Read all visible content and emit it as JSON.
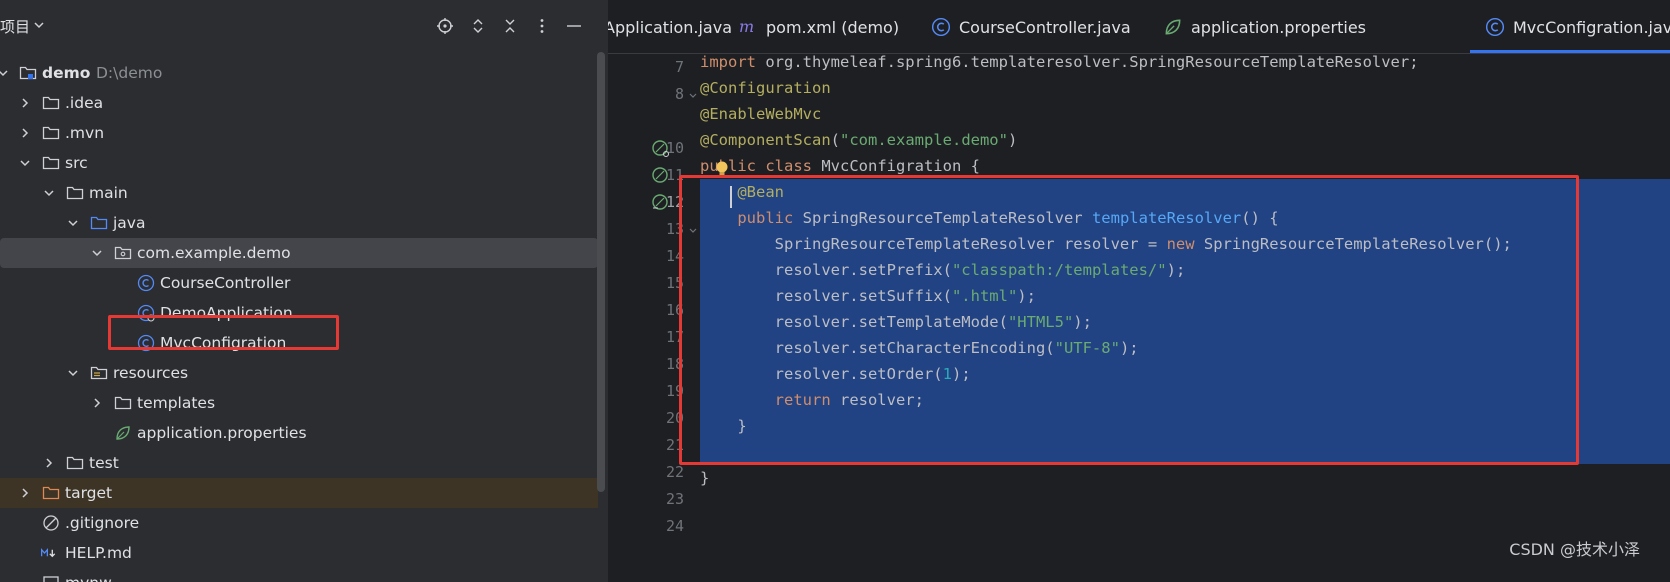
{
  "project_panel": {
    "title": "项目",
    "tree": [
      {
        "label": "demo",
        "path": "D:\\demo"
      },
      {
        "label": ".idea"
      },
      {
        "label": ".mvn"
      },
      {
        "label": "src"
      },
      {
        "label": "main"
      },
      {
        "label": "java"
      },
      {
        "label": "com.example.demo"
      },
      {
        "label": "CourseController"
      },
      {
        "label": "DemoApplication"
      },
      {
        "label": "MvcConfigration"
      },
      {
        "label": "resources"
      },
      {
        "label": "templates"
      },
      {
        "label": "application.properties"
      },
      {
        "label": "test"
      },
      {
        "label": "target"
      },
      {
        "label": ".gitignore"
      },
      {
        "label": "HELP.md"
      },
      {
        "label": "mvnw"
      }
    ]
  },
  "tabs": [
    {
      "label": "Application.java"
    },
    {
      "label": "pom.xml (demo)"
    },
    {
      "label": "CourseController.java"
    },
    {
      "label": "application.properties"
    },
    {
      "label": "MvcConfigration.java"
    }
  ],
  "code": {
    "line_numbers": [
      "7",
      "8",
      "10",
      "11",
      "12",
      "13",
      "14",
      "15",
      "16",
      "17",
      "18",
      "19",
      "20",
      "21",
      "22",
      "23",
      "24"
    ],
    "lines": [
      {
        "tokens": [
          [
            "kw",
            "import "
          ],
          [
            "plain",
            "org.thymeleaf.spring6.templateresolver.SpringResourceTemplateResolver;"
          ]
        ]
      },
      {
        "tokens": [
          [
            "ann",
            "@Configuration"
          ]
        ]
      },
      {
        "tokens": [
          [
            "ann",
            "@EnableWebMvc"
          ]
        ]
      },
      {
        "tokens": [
          [
            "ann",
            "@ComponentScan"
          ],
          [
            "plain",
            "("
          ],
          [
            "str",
            "\"com.example.demo\""
          ],
          [
            "plain",
            ")"
          ]
        ]
      },
      {
        "tokens": [
          [
            "kw",
            "public class "
          ],
          [
            "plain",
            "MvcConfigration {"
          ]
        ]
      },
      {
        "tokens": [
          [
            "plain",
            "    "
          ],
          [
            "ann",
            "@Bean"
          ]
        ]
      },
      {
        "tokens": [
          [
            "plain",
            "    "
          ],
          [
            "kw",
            "public "
          ],
          [
            "plain",
            "SpringResourceTemplateResolver "
          ],
          [
            "fn",
            "templateResolver"
          ],
          [
            "plain",
            "() {"
          ]
        ]
      },
      {
        "tokens": [
          [
            "plain",
            "        SpringResourceTemplateResolver resolver = "
          ],
          [
            "kw",
            "new "
          ],
          [
            "plain",
            "SpringResourceTemplateResolver();"
          ]
        ]
      },
      {
        "tokens": [
          [
            "plain",
            "        resolver.setPrefix("
          ],
          [
            "str",
            "\"classpath:/templates/\""
          ],
          [
            "plain",
            ");"
          ]
        ]
      },
      {
        "tokens": [
          [
            "plain",
            "        resolver.setSuffix("
          ],
          [
            "str",
            "\".html\""
          ],
          [
            "plain",
            ");"
          ]
        ]
      },
      {
        "tokens": [
          [
            "plain",
            "        resolver.setTemplateMode("
          ],
          [
            "str",
            "\"HTML5\""
          ],
          [
            "plain",
            ");"
          ]
        ]
      },
      {
        "tokens": [
          [
            "plain",
            "        resolver.setCharacterEncoding("
          ],
          [
            "str",
            "\"UTF-8\""
          ],
          [
            "plain",
            ");"
          ]
        ]
      },
      {
        "tokens": [
          [
            "plain",
            "        resolver.setOrder("
          ],
          [
            "num",
            "1"
          ],
          [
            "plain",
            ");"
          ]
        ]
      },
      {
        "tokens": [
          [
            "plain",
            "        "
          ],
          [
            "kw",
            "return "
          ],
          [
            "plain",
            "resolver;"
          ]
        ]
      },
      {
        "tokens": [
          [
            "plain",
            "    }"
          ]
        ]
      },
      {
        "tokens": [
          [
            "plain",
            ""
          ]
        ]
      },
      {
        "tokens": [
          [
            "plain",
            "}"
          ]
        ]
      },
      {
        "tokens": [
          [
            "plain",
            ""
          ]
        ]
      }
    ]
  },
  "watermark": "CSDN @技术小泽",
  "colors": {
    "selection": "#214283",
    "annotation_box": "#e53935",
    "accent": "#3574f0"
  }
}
